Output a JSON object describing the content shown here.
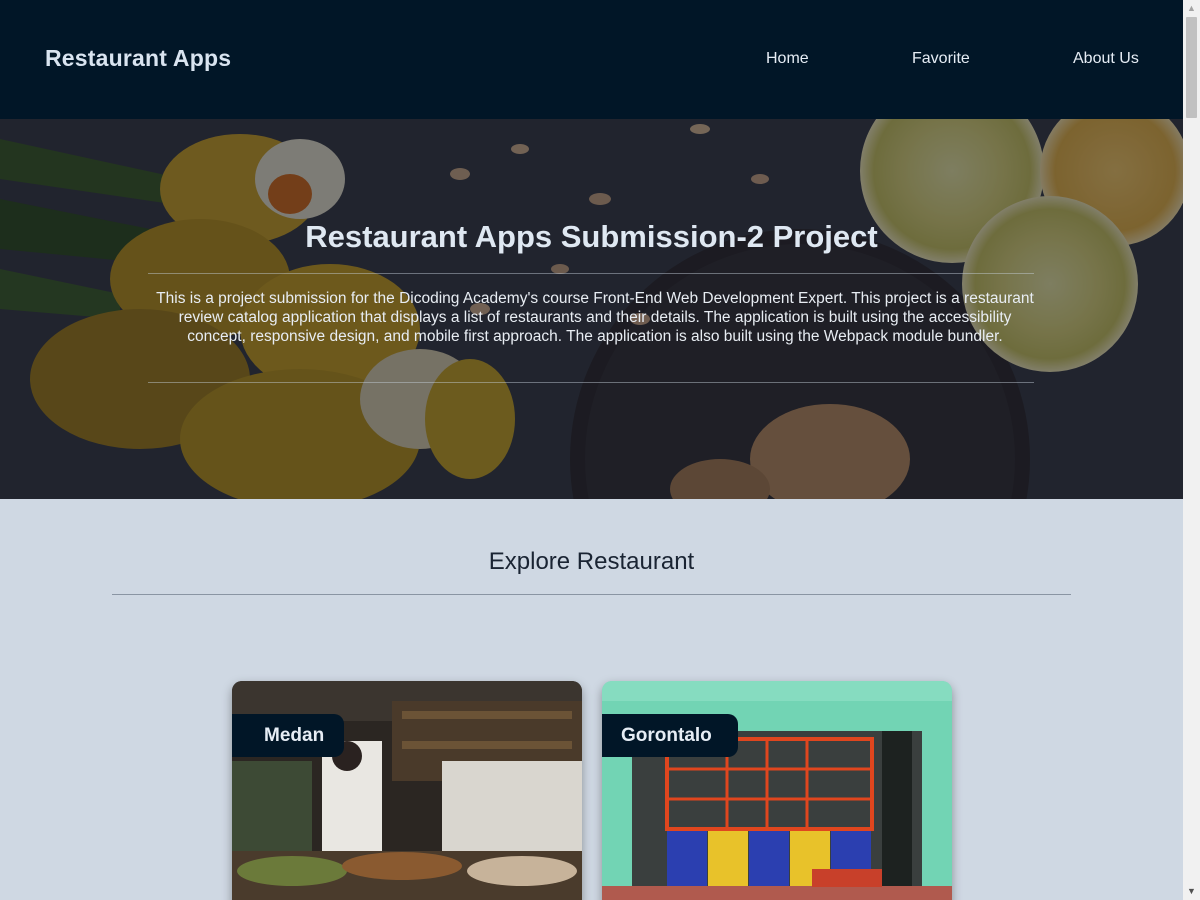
{
  "header": {
    "brand": "Restaurant Apps",
    "nav": [
      "Home",
      "Favorite",
      "About Us"
    ]
  },
  "hero": {
    "title": "Restaurant Apps Submission-2 Project",
    "description": "This is a project submission for the Dicoding Academy's course Front-End Web Development Expert. This project is a restaurant review catalog application that displays a list of restaurants and their details. The application is built using the accessibility concept, responsive design, and mobile first approach. The application is also built using the Webpack module bundler."
  },
  "explore": {
    "title": "Explore Restaurant",
    "cards": [
      {
        "city": "Medan"
      },
      {
        "city": "Gorontalo"
      }
    ]
  },
  "colors": {
    "app_bar": "#011627",
    "page_bg": "#cfd8e3"
  },
  "scrollbar": {
    "up_icon": "triangle-up-icon",
    "down_icon": "triangle-down-icon"
  }
}
